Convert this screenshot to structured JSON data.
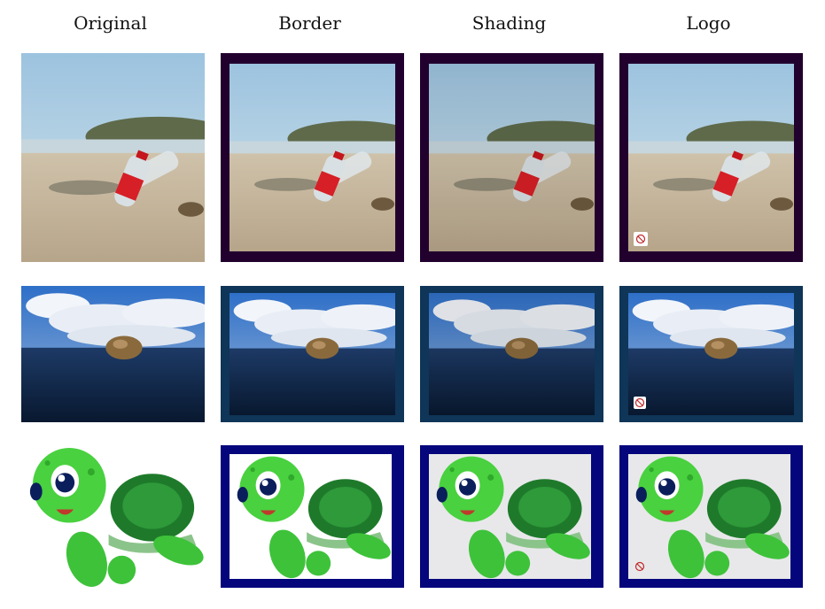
{
  "columns": {
    "original": "Original",
    "border": "Border",
    "shading": "Shading",
    "logo": "Logo"
  },
  "rows": [
    {
      "subject": "beach-bottles",
      "frame_color": "#22002e"
    },
    {
      "subject": "ocean-turtle",
      "frame_color": "#0f3558"
    },
    {
      "subject": "cartoon-turtle",
      "frame_color": "#05057c"
    }
  ],
  "icons": {
    "logo_mark": "no-symbol-icon"
  }
}
